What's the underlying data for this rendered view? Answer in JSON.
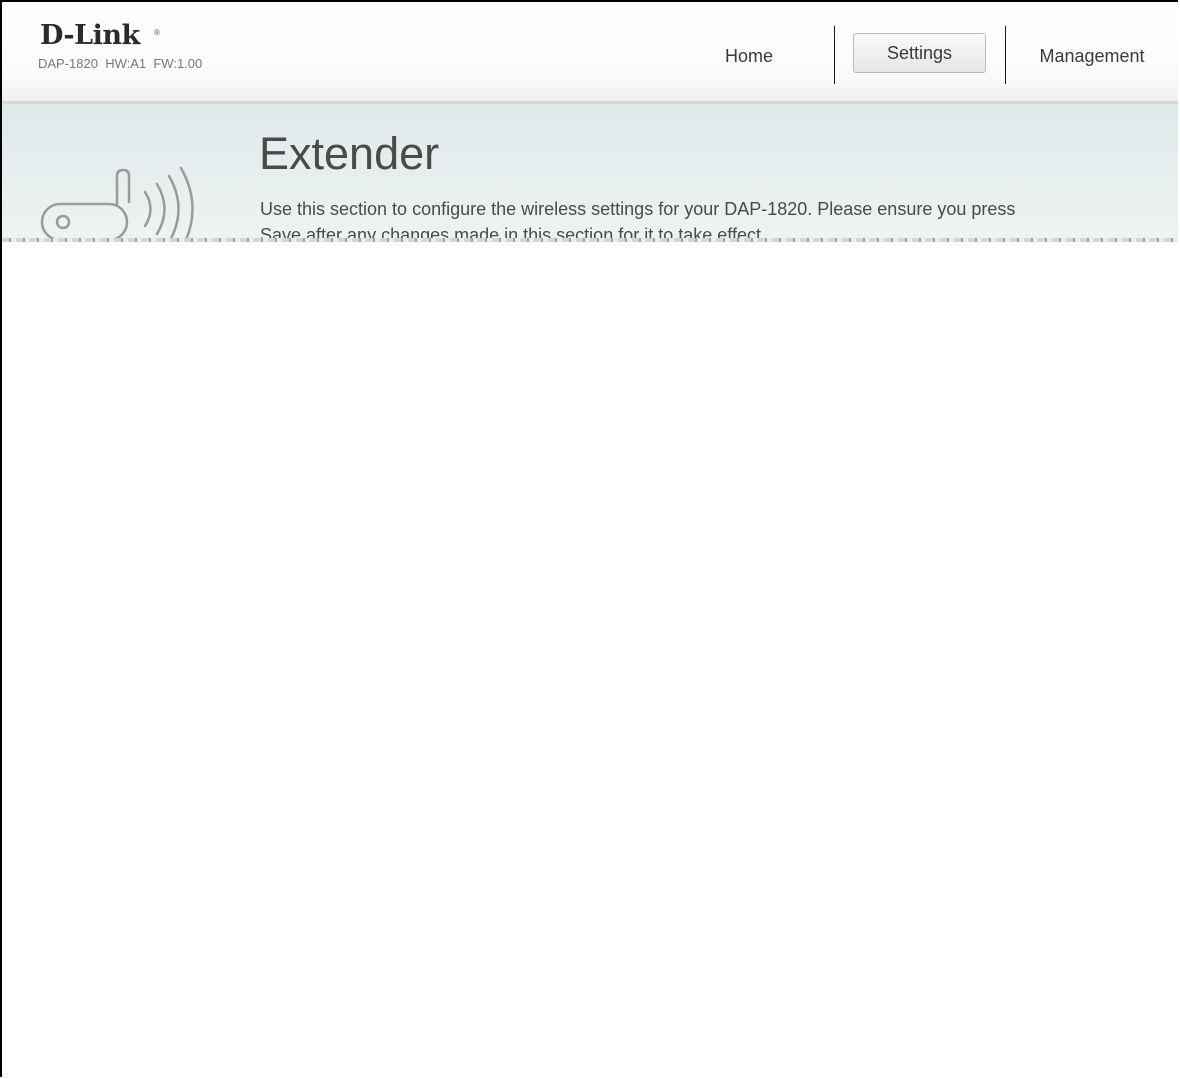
{
  "brand": {
    "logo_text": "D-Link",
    "logo_mark": "®",
    "model_info": "DAP-1820  HW:A1  FW:1.00"
  },
  "nav": {
    "home": "Home",
    "settings": "Settings",
    "management": "Management",
    "active": "Settings"
  },
  "page": {
    "title": "Extender",
    "description": "Use this section to configure the wireless settings for your DAP-1820. Please ensure you press Save after any changes made in this section for it to take effect.",
    "icon": "router-wireless-icon"
  },
  "colors": {
    "banner_bg": "#e4ecec",
    "text": "#4a4a4a",
    "header_border": "#d7d7d7"
  }
}
